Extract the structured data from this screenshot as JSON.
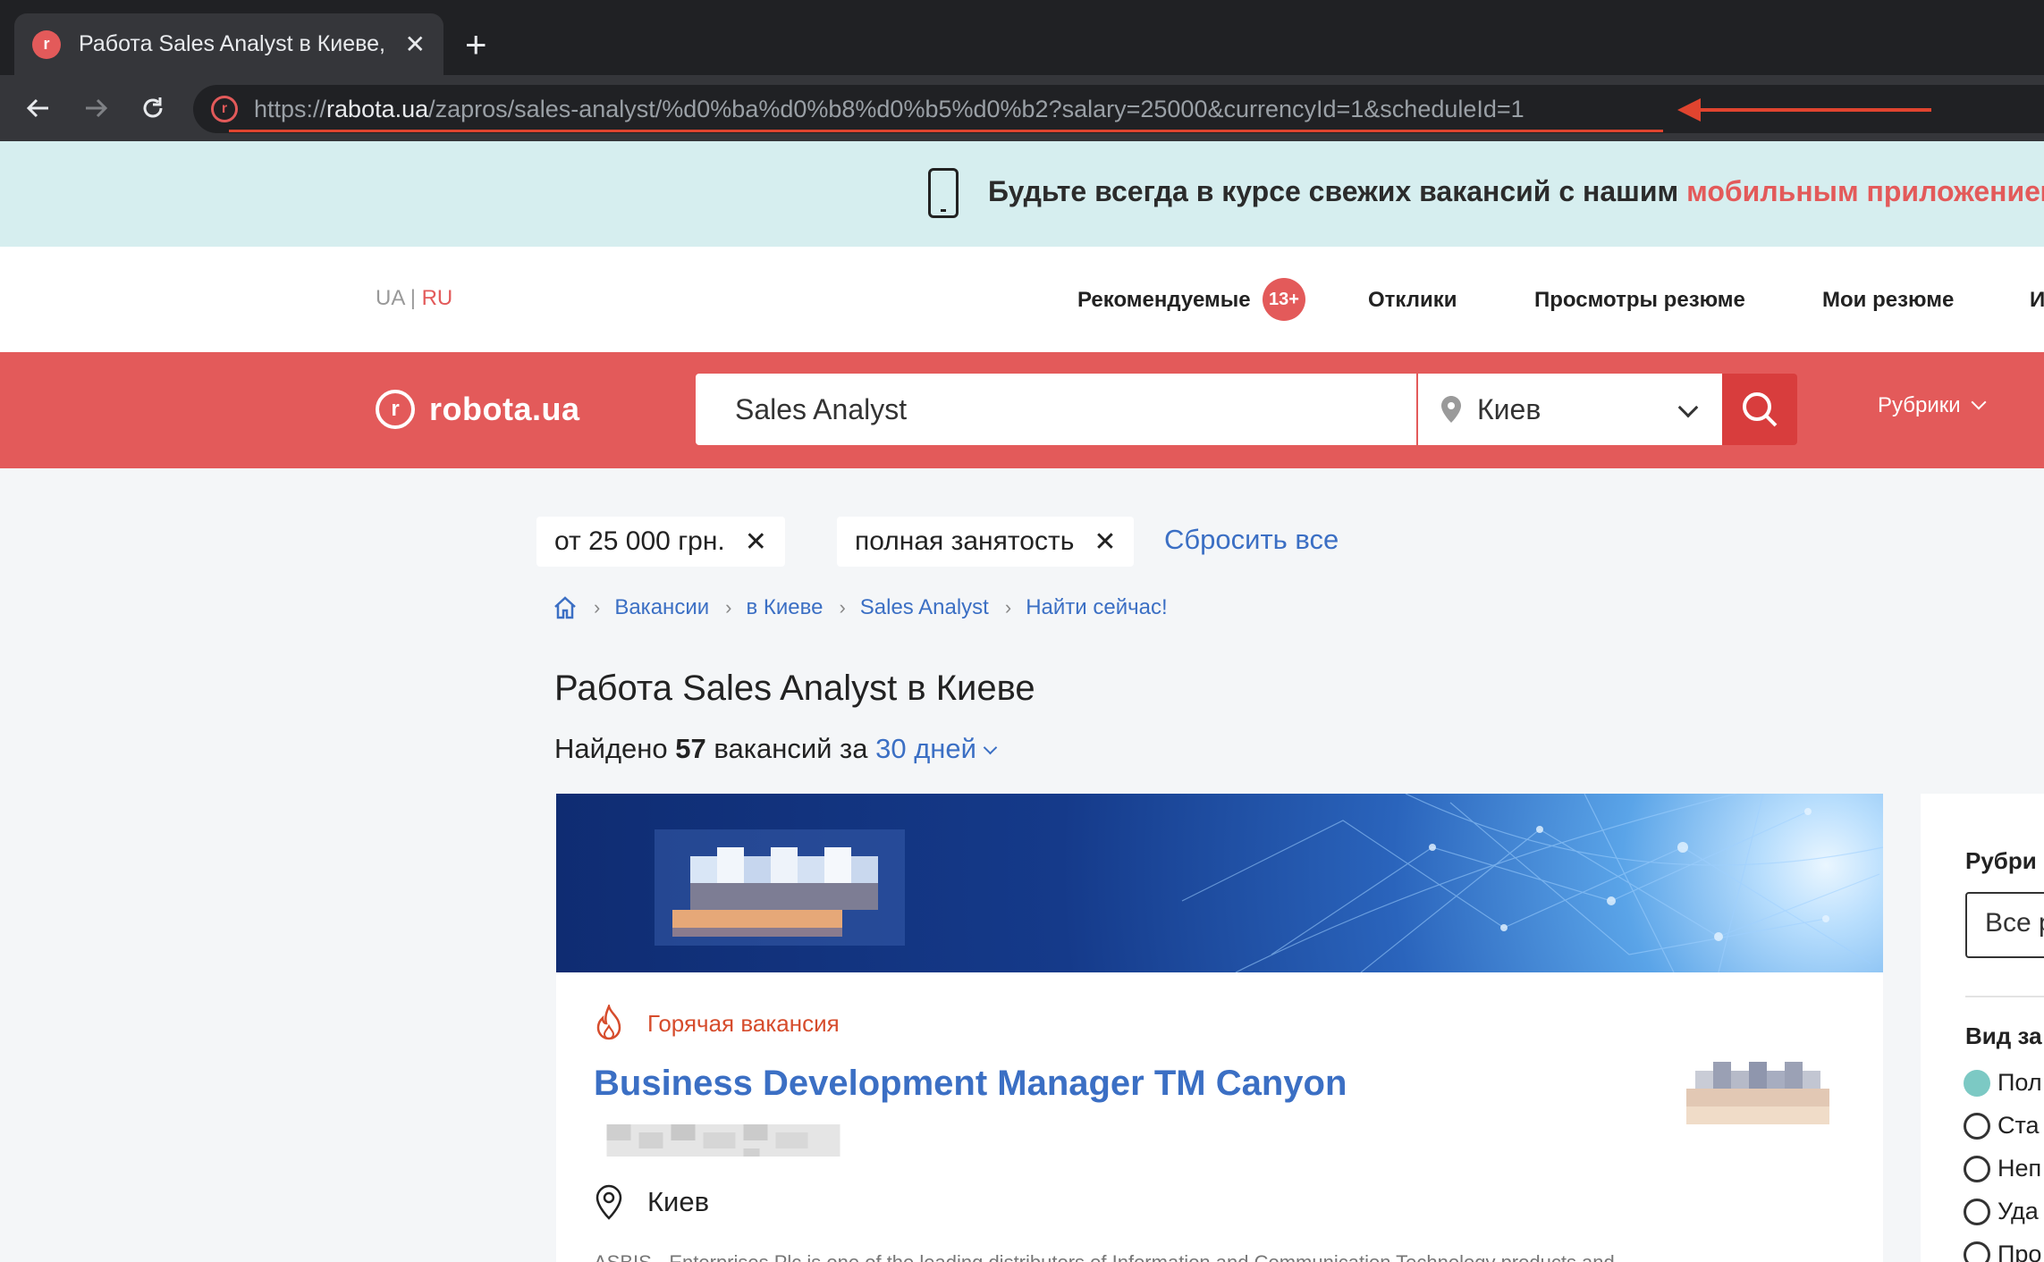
{
  "browser": {
    "tab_title": "Работа Sales Analyst в Киеве, ",
    "tab_close": "✕",
    "new_tab": "+",
    "url_prefix": "https://",
    "url_host": "rabota.ua",
    "url_path": "/zapros/sales-analyst/%d0%ba%d0%b8%d0%b5%d0%b2?salary=25000&currencyId=1&scheduleId=1",
    "icons": {
      "back": "arrow-left",
      "forward": "arrow-right",
      "reload": "reload"
    }
  },
  "promo": {
    "text": "Будьте всегда в курсе свежих вакансий с нашим ",
    "link": "мобильным приложением"
  },
  "topnav": {
    "lang_ua": "UA",
    "lang_sep": "|",
    "lang_ru": "RU",
    "recommended": "Рекомендуемые",
    "recommended_badge": "13+",
    "responses": "Отклики",
    "resume_views": "Просмотры резюме",
    "my_resumes": "Мои резюме",
    "cut_item": "И"
  },
  "header": {
    "logo_letter": "r",
    "logo_text": "robota.ua",
    "search_value": "Sales Analyst",
    "city_value": "Киев",
    "rubriki": "Рубрики"
  },
  "filters": {
    "chips": [
      {
        "label": "от 25 000 грн.",
        "remove": "✕"
      },
      {
        "label": "полная занятость",
        "remove": "✕"
      }
    ],
    "reset_all": "Сбросить все"
  },
  "breadcrumb": {
    "items": [
      "Вакансии",
      "в Киеве",
      "Sales Analyst",
      "Найти сейчас!"
    ],
    "sep": "›"
  },
  "results": {
    "title": "Работа Sales Analyst в Киеве",
    "found_prefix": "Найдено ",
    "found_count": "57",
    "found_suffix": " вакансий за ",
    "period": "30 дней"
  },
  "vacancy": {
    "hot_label": "Горячая вакансия",
    "title": "Business Development Manager TM Canyon",
    "location": "Киев",
    "description_cut": "ASBIS - Enterprises Plc is one of the leading distributors of Information and Communication Technology products and"
  },
  "side_panel": {
    "rubric_heading": "Рубри",
    "rubric_select": "Все р",
    "employment_heading": "Вид за",
    "options": [
      {
        "label": "Пол",
        "checked": true
      },
      {
        "label": "Ста",
        "checked": false
      },
      {
        "label": "Неп",
        "checked": false
      },
      {
        "label": "Уда",
        "checked": false
      },
      {
        "label": "Про",
        "checked": false
      }
    ]
  },
  "colors": {
    "brand": "#e35a5a",
    "link": "#3b6fc4",
    "hot": "#d64c2c",
    "annotation": "#e0442f"
  }
}
